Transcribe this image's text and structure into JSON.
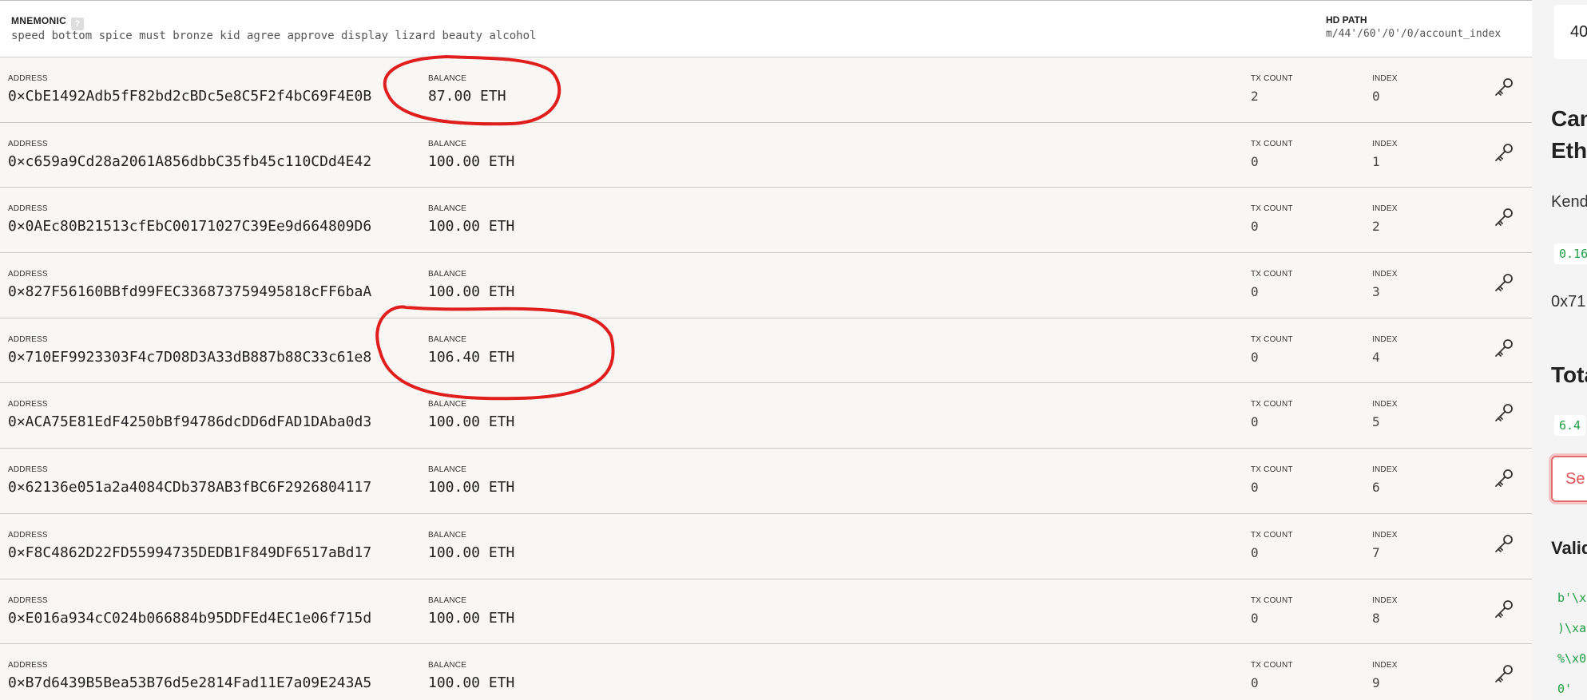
{
  "mnemonic": {
    "label": "MNEMONIC",
    "help_glyph": "?",
    "words": "speed bottom spice must bronze kid agree approve display lizard beauty alcohol"
  },
  "hd_path": {
    "label": "HD PATH",
    "value": "m/44'/60'/0'/0/account_index"
  },
  "column_labels": {
    "address": "ADDRESS",
    "balance": "BALANCE",
    "tx_count": "TX COUNT",
    "index": "INDEX"
  },
  "accounts": [
    {
      "address": "0×CbE1492Adb5fF82bd2cBDc5e8C5F2f4bC69F4E0B",
      "balance": "87.00 ETH",
      "tx_count": "2",
      "index": "0"
    },
    {
      "address": "0×c659a9Cd28a2061A856dbbC35fb45c110CDd4E42",
      "balance": "100.00 ETH",
      "tx_count": "0",
      "index": "1"
    },
    {
      "address": "0×0AEc80B21513cfEbC00171027C39Ee9d664809D6",
      "balance": "100.00 ETH",
      "tx_count": "0",
      "index": "2"
    },
    {
      "address": "0×827F56160BBfd99FEC336873759495818cFF6baA",
      "balance": "100.00 ETH",
      "tx_count": "0",
      "index": "3"
    },
    {
      "address": "0×710EF9923303F4c7D08D3A33dB887b88C33c61e8",
      "balance": "106.40 ETH",
      "tx_count": "0",
      "index": "4"
    },
    {
      "address": "0×ACA75E81EdF4250bBf94786dcDD6dFAD1DAba0d3",
      "balance": "100.00 ETH",
      "tx_count": "0",
      "index": "5"
    },
    {
      "address": "0×62136e051a2a4084CDb378AB3fBC6F2926804117",
      "balance": "100.00 ETH",
      "tx_count": "0",
      "index": "6"
    },
    {
      "address": "0×F8C4862D22FD55994735DEDB1F849DF6517aBd17",
      "balance": "100.00 ETH",
      "tx_count": "0",
      "index": "7"
    },
    {
      "address": "0×E016a934cC024b066884b95DDFEd4EC1e06f715d",
      "balance": "100.00 ETH",
      "tx_count": "0",
      "index": "8"
    },
    {
      "address": "0×B7d6439B5Bea53B76d5e2814Fad11E7a09E243A5",
      "balance": "100.00 ETH",
      "tx_count": "0",
      "index": "9"
    }
  ],
  "right_panel": {
    "box_text": "40",
    "heading_1_line1": "Can",
    "heading_1_line2": "Eth",
    "text_1": "Kend",
    "code_1": "0.16",
    "text_2": "0x71",
    "heading_2": "Tota",
    "code_2": "6.4",
    "button_label": "Se",
    "heading_3": "Valid",
    "code_lines": [
      "b'\\x",
      ")\\xa",
      "%\\x0",
      "0'"
    ]
  },
  "colors": {
    "annotation_red": "#e01e1e",
    "code_green": "#22a046",
    "row_background": "#f8f7f4"
  },
  "icons": {
    "row_action": "key-icon"
  }
}
